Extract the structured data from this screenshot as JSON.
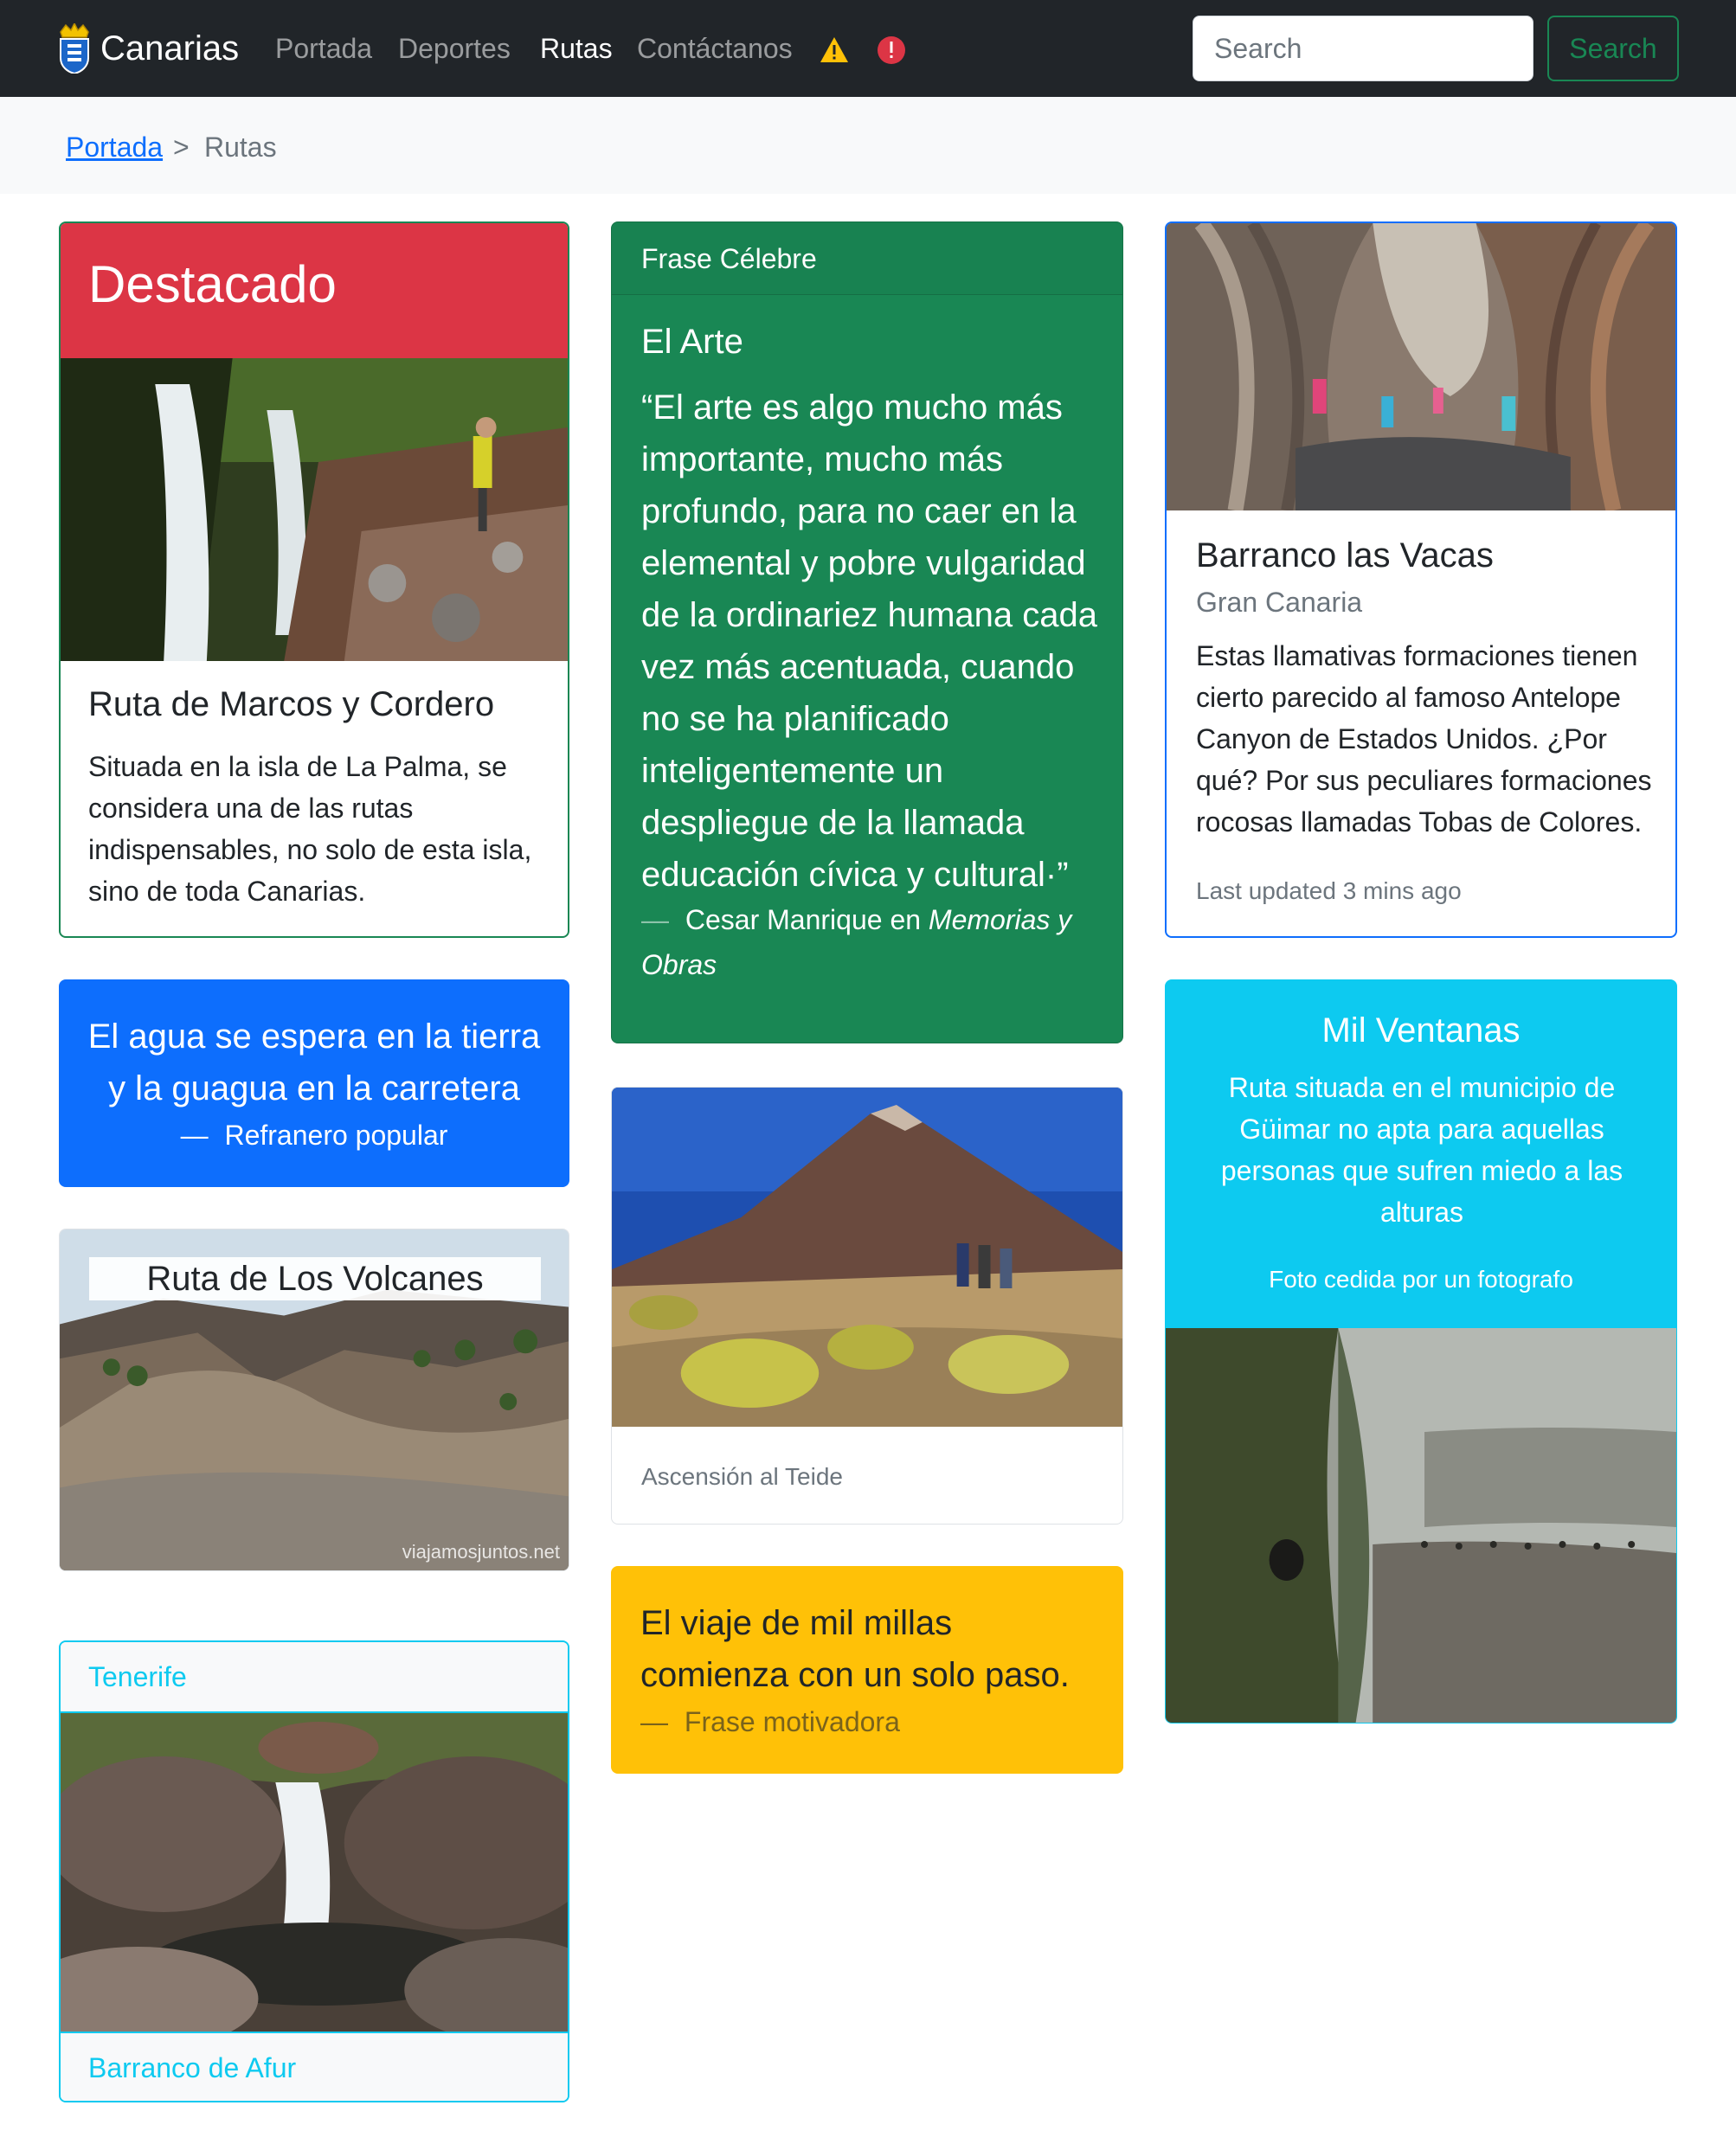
{
  "navbar": {
    "brand": "Canarias",
    "links": [
      "Portada",
      "Deportes",
      "Rutas",
      "Contáctanos"
    ],
    "active_link": "Rutas",
    "search_placeholder": "Search",
    "search_button": "Search"
  },
  "breadcrumb": {
    "home": "Portada",
    "separator": ">",
    "current": "Rutas"
  },
  "cards": {
    "featured": {
      "header": "Destacado",
      "title": "Ruta de Marcos y Cordero",
      "text": "Situada en la isla de La Palma, se considera una de las rutas indispensables, no solo de esta isla, sino de toda Canarias."
    },
    "famous_quote": {
      "header": "Frase Célebre",
      "title": "El Arte",
      "quote": "“El arte es algo mucho más importante, mucho más profundo, para no caer en la elemental y pobre vulgaridad de la ordinariez humana cada vez más acentuada, cuando no se ha planificado inteligentemente un despliegue de la llamada educación cívica y cultural·”",
      "dash": "—",
      "author": "Cesar Manrique en",
      "source": "Memorias y Obras"
    },
    "barranco_vacas": {
      "title": "Barranco las Vacas",
      "subtitle": "Gran Canaria",
      "text": "Estas llamativas formaciones tienen cierto parecido al famoso Antelope Canyon de Estados Unidos. ¿Por qué? Por sus peculiares formaciones rocosas llamadas Tobas de Colores.",
      "updated": "Last updated 3 mins ago"
    },
    "blue_quote": {
      "quote": "El agua se espera en la tierra y la guagua en la carretera",
      "dash": "—",
      "source": "Refranero popular"
    },
    "volcanes": {
      "title": "Ruta de Los Volcanes",
      "watermark": "viajamosjuntos.net"
    },
    "teide": {
      "caption": "Ascensión al Teide"
    },
    "tenerife": {
      "header": "Tenerife",
      "footer": "Barranco de Afur"
    },
    "yellow_quote": {
      "quote": "El viaje de mil millas comienza con un solo paso.",
      "dash": "—",
      "source": "Frase motivadora"
    },
    "mil_ventanas": {
      "title": "Mil Ventanas",
      "text": "Ruta situada en el municipio de Güimar no apta para aquellas personas que sufren miedo a las alturas",
      "credit": "Foto cedida por un fotografo"
    }
  },
  "colors": {
    "navbar_bg": "#212529",
    "danger": "#dc3545",
    "success": "#198754",
    "primary": "#0d6efd",
    "info": "#0dcaf0",
    "warning": "#ffc107"
  }
}
